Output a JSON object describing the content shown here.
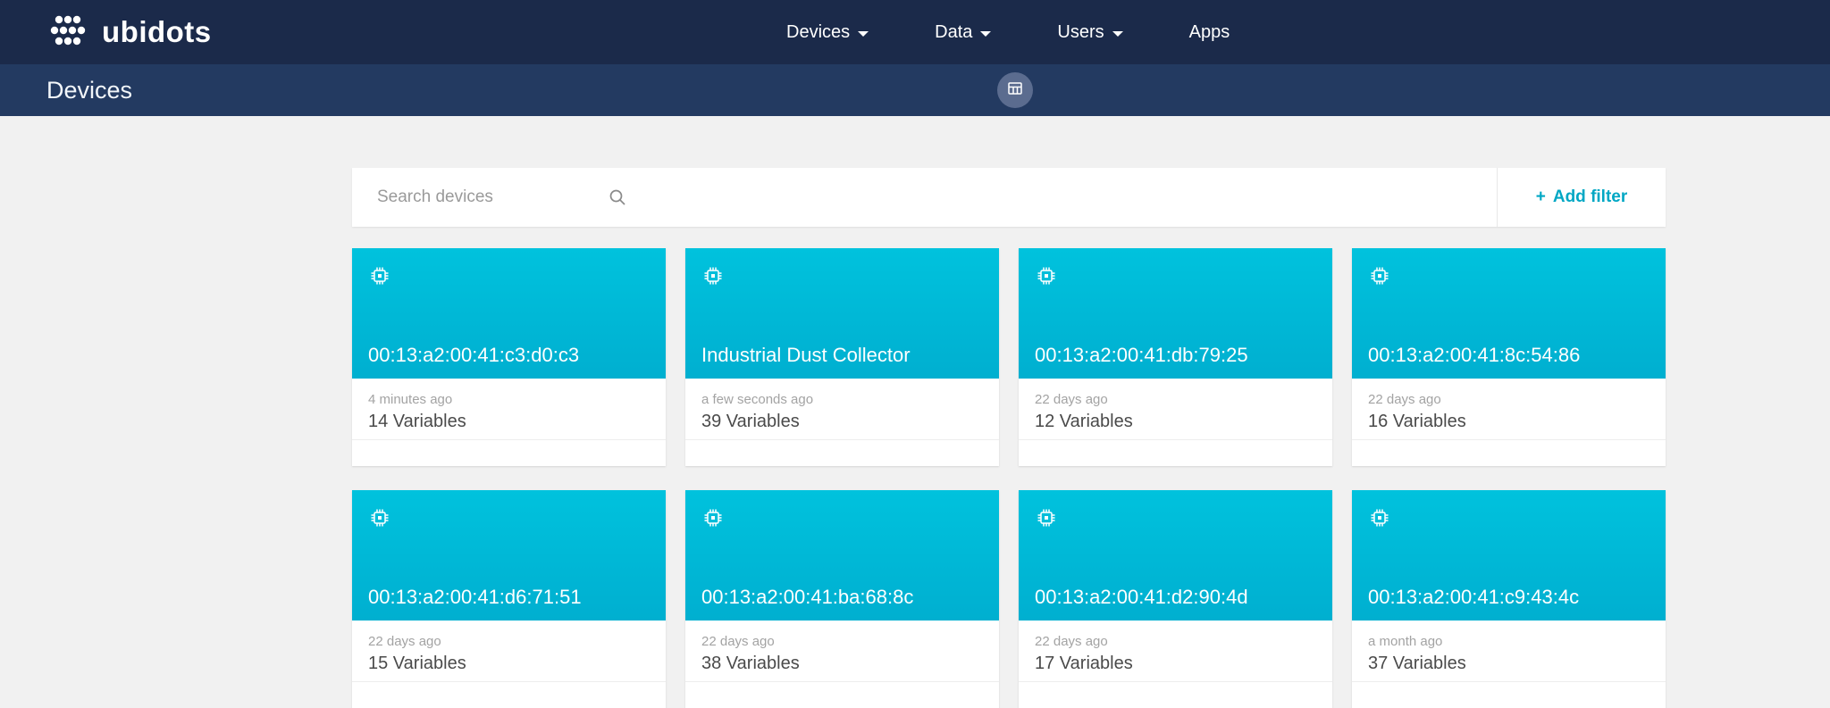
{
  "navbar": {
    "brand": "ubidots",
    "items": [
      {
        "label": "Devices",
        "caret": true
      },
      {
        "label": "Data",
        "caret": true
      },
      {
        "label": "Users",
        "caret": true
      },
      {
        "label": "Apps",
        "caret": false
      }
    ]
  },
  "subheader": {
    "title": "Devices"
  },
  "toolbar": {
    "search_placeholder": "Search devices",
    "add_filter_icon": "+",
    "add_filter_label": "Add filter"
  },
  "devices": [
    {
      "name": "00:13:a2:00:41:c3:d0:c3",
      "last_activity": "4 minutes ago",
      "variables": "14 Variables"
    },
    {
      "name": "Industrial Dust Collector",
      "last_activity": "a few seconds ago",
      "variables": "39 Variables"
    },
    {
      "name": "00:13:a2:00:41:db:79:25",
      "last_activity": "22 days ago",
      "variables": "12 Variables"
    },
    {
      "name": "00:13:a2:00:41:8c:54:86",
      "last_activity": "22 days ago",
      "variables": "16 Variables"
    },
    {
      "name": "00:13:a2:00:41:d6:71:51",
      "last_activity": "22 days ago",
      "variables": "15 Variables"
    },
    {
      "name": "00:13:a2:00:41:ba:68:8c",
      "last_activity": "22 days ago",
      "variables": "38 Variables"
    },
    {
      "name": "00:13:a2:00:41:d2:90:4d",
      "last_activity": "22 days ago",
      "variables": "17 Variables"
    },
    {
      "name": "00:13:a2:00:41:c9:43:4c",
      "last_activity": "a month ago",
      "variables": "37 Variables"
    }
  ],
  "colors": {
    "navbar": "#1b2a4a",
    "subheader": "#233a61",
    "card_header_top": "#00c2dd",
    "card_header_bottom": "#00afd0",
    "accent": "#00a7c4",
    "page_bg": "#f1f1f1"
  }
}
